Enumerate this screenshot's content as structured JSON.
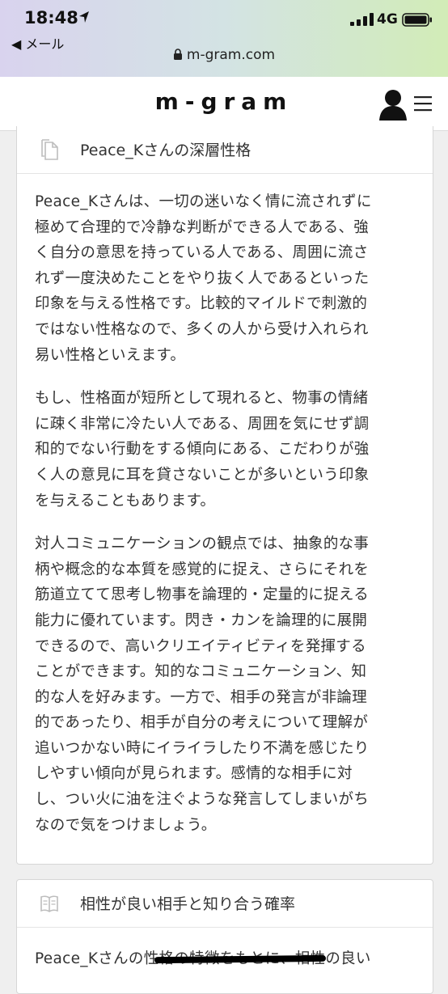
{
  "status_bar": {
    "time": "18:48",
    "back_label": "◀ メール",
    "network": "4G"
  },
  "url_bar": {
    "url": "m-gram.com"
  },
  "header": {
    "logo": "m-gram"
  },
  "sections": [
    {
      "title": "Peace_Kさんの深層性格",
      "paragraphs": [
        "Peace_Kさんは、一切の迷いなく情に流されずに\n極めて合理的で冷静な判断ができる人である、強\nく自分の意思を持っている人である、周囲に流さ\nれず一度決めたことをやり抜く人であるといった\n印象を与える性格です。比較的マイルドで刺激的\nではない性格なので、多くの人から受け入れられ\n易い性格といえます。",
        "もし、性格面が短所として現れると、物事の情緒\nに疎く非常に冷たい人である、周囲を気にせず調\n和的でない行動をする傾向にある、こだわりが強\nく人の意見に耳を貸さないことが多いという印象\nを与えることもあります。",
        "対人コミュニケーションの観点では、抽象的な事\n柄や概念的な本質を感覚的に捉え、さらにそれを\n筋道立てて思考し物事を論理的・定量的に捉える\n能力に優れています。閃き・カンを論理的に展開\nできるので、高いクリエイティビティを発揮する\nことができます。知的なコミュニケーション、知\n的な人を好みます。一方で、相手の発言が非論理\n的であったり、相手が自分の考えについて理解が\n追いつかない時にイライラしたり不満を感じたり\nしやすい傾向が見られます。感情的な相手に対\nし、つい火に油を注ぐような発言してしまいがち\nなので気をつけましょう。"
      ]
    },
    {
      "title": "相性が良い相手と知り合う確率",
      "paragraphs": [
        "Peace_Kさんの性格の特徴をもとに、相性の良い"
      ]
    }
  ]
}
